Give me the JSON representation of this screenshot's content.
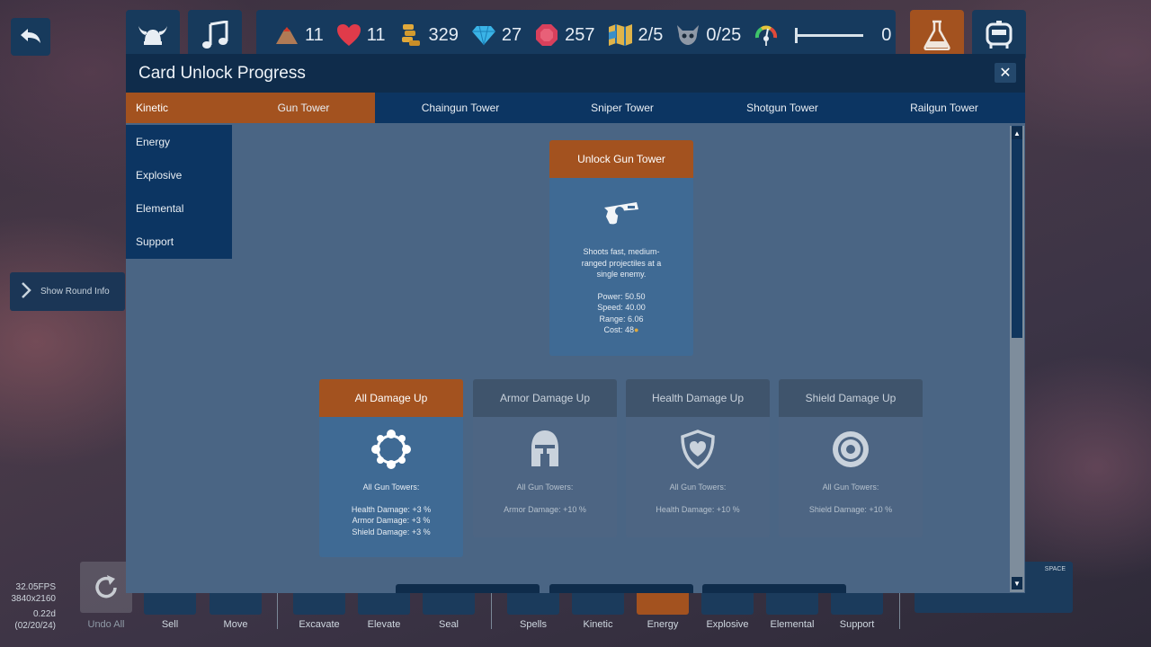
{
  "resources": {
    "lives": "11",
    "health": "11",
    "gold": "329",
    "gems": "27",
    "crystals": "257",
    "maps": "2/5",
    "enemies": "0/25",
    "speed_value": "0"
  },
  "round_info": {
    "label": "Show Round Info"
  },
  "stats": {
    "fps": "32.05FPS",
    "resolution": "3840x2160",
    "version": "0.22d",
    "date": "(02/20/24)"
  },
  "toolbar": {
    "undo_all": "Undo All",
    "sell": "Sell",
    "move": "Move",
    "excavate": "Excavate",
    "elevate": "Elevate",
    "seal": "Seal",
    "spells": "Spells",
    "kinetic": "Kinetic",
    "energy": "Energy",
    "explosive": "Explosive",
    "elemental": "Elemental",
    "support": "Support",
    "space_hint": "SPACE"
  },
  "modal": {
    "title": "Card Unlock Progress",
    "close_symbol": "✕",
    "categories": [
      "Kinetic",
      "Energy",
      "Explosive",
      "Elemental",
      "Support"
    ],
    "tabs": [
      "Gun Tower",
      "Chaingun Tower",
      "Sniper Tower",
      "Shotgun Tower",
      "Railgun Tower"
    ],
    "unlock_card": {
      "title": "Unlock Gun Tower",
      "description": "Shoots fast, medium-ranged projectiles at a single enemy.",
      "power": "Power: 50.50",
      "speed": "Speed: 40.00",
      "range": "Range: 6.06",
      "cost": "Cost: 48"
    },
    "upgrades": [
      {
        "title": "All Damage Up",
        "target": "All Gun Towers:",
        "lines": [
          "Health Damage: +3 %",
          "Armor Damage: +3 %",
          "Shield Damage: +3 %"
        ]
      },
      {
        "title": "Armor Damage Up",
        "target": "All Gun Towers:",
        "lines": [
          "Armor Damage: +10 %"
        ]
      },
      {
        "title": "Health Damage Up",
        "target": "All Gun Towers:",
        "lines": [
          "Health Damage: +10 %"
        ]
      },
      {
        "title": "Shield Damage Up",
        "target": "All Gun Towers:",
        "lines": [
          "Shield Damage: +10 %"
        ]
      }
    ]
  },
  "colors": {
    "accent": "#a3521f",
    "panel": "#0c3562",
    "modal_bg": "#4a6584"
  }
}
